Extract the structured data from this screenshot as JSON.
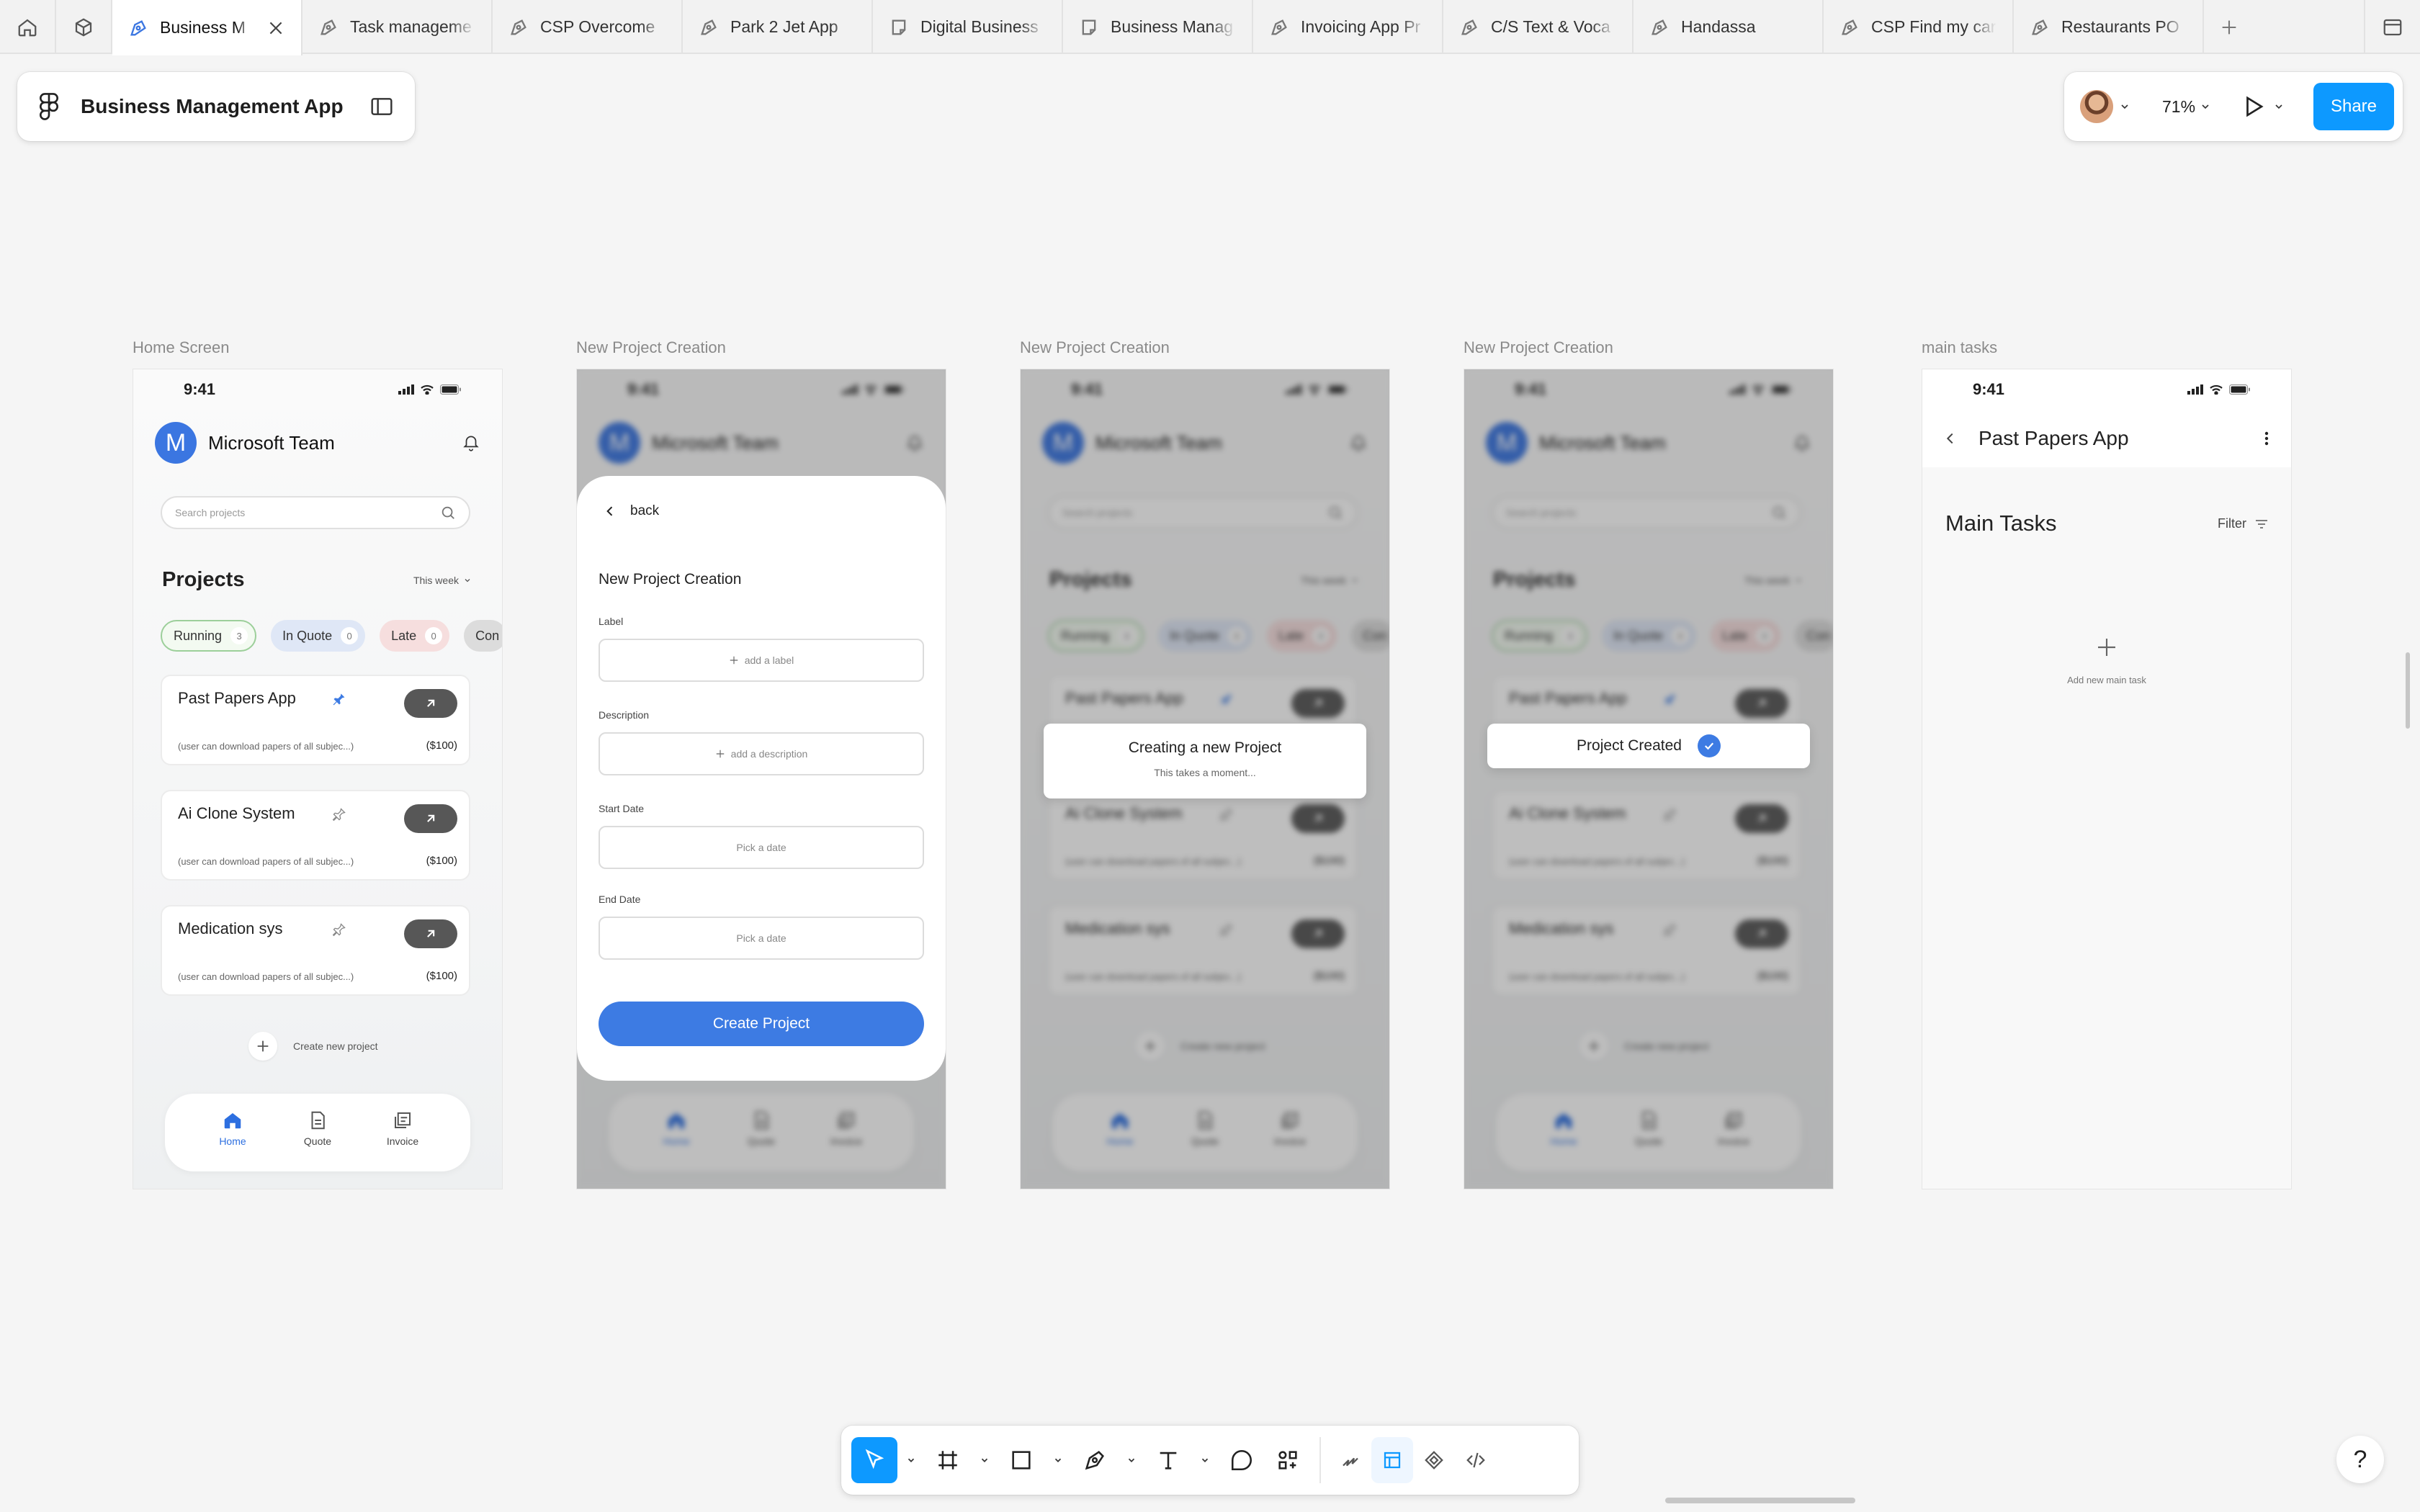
{
  "tabs": [
    {
      "label": "Business M",
      "active": true
    },
    {
      "label": "Task manageme"
    },
    {
      "label": "CSP Overcome"
    },
    {
      "label": "Park 2 Jet App"
    },
    {
      "label": "Digital Business"
    },
    {
      "label": "Business Manag"
    },
    {
      "label": "Invoicing App Pr"
    },
    {
      "label": "C/S Text & Voca"
    },
    {
      "label": "Handassa"
    },
    {
      "label": "CSP Find my car"
    },
    {
      "label": "Restaurants PO"
    }
  ],
  "file": {
    "title": "Business Management App"
  },
  "toolbar_right": {
    "zoom": "71%",
    "share_label": "Share"
  },
  "frames": {
    "home": "Home Screen",
    "new1": "New Project Creation",
    "new2": "New Project Creation",
    "new3": "New Project Creation",
    "tasks": "main tasks"
  },
  "app": {
    "time": "9:41",
    "team_initial": "M",
    "team_name": "Microsoft Team",
    "search_placeholder": "Search projects",
    "projects_title": "Projects",
    "week_filter": "This week",
    "chips": [
      {
        "label": "Running",
        "count": "3"
      },
      {
        "label": "In Quote",
        "count": "0"
      },
      {
        "label": "Late",
        "count": "0"
      },
      {
        "label": "Con"
      }
    ],
    "cards": [
      {
        "name": "Past Papers App",
        "desc": "(user can download papers of all subjec...)",
        "price": "($100)",
        "pinned": true
      },
      {
        "name": "Ai Clone System",
        "desc": "(user can download papers of all subjec...)",
        "price": "($100)",
        "pinned": false
      },
      {
        "name": "Medication sys",
        "desc": "(user can download papers of all subjec...)",
        "price": "($100)",
        "pinned": false
      }
    ],
    "create_new": "Create new project",
    "nav": {
      "home": "Home",
      "quote": "Quote",
      "invoice": "Invoice"
    }
  },
  "new_project": {
    "back": "back",
    "title": "New Project Creation",
    "label_title": "Label",
    "label_placeholder": "add a label",
    "desc_title": "Description",
    "desc_placeholder": "add a description",
    "start_title": "Start Date",
    "start_placeholder": "Pick a date",
    "end_title": "End Date",
    "end_placeholder": "Pick a date",
    "button": "Create Project"
  },
  "loading": {
    "title": "Creating a new Project",
    "subtitle": "This takes a moment..."
  },
  "created": {
    "title": "Project Created"
  },
  "tasks": {
    "time": "9:41",
    "app_title": "Past Papers App",
    "main_title": "Main Tasks",
    "filter": "Filter",
    "add_label": "Add new main task"
  },
  "colors": {
    "accent": "#0d99ff",
    "app_blue": "#3d7be3"
  }
}
